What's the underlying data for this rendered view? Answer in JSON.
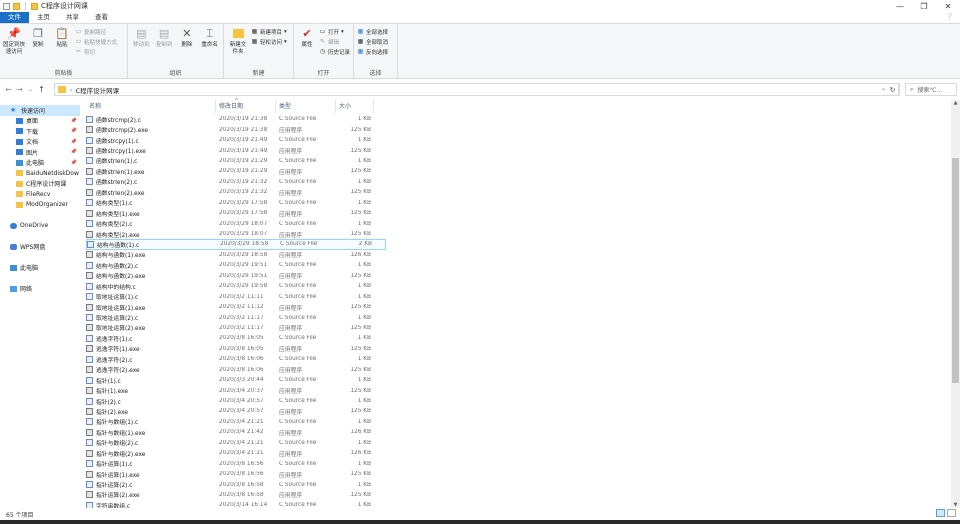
{
  "window": {
    "title": "C程序设计网课",
    "controls": [
      "—",
      "❐",
      "✕"
    ]
  },
  "tabs": [
    "文件",
    "主页",
    "共享",
    "查看"
  ],
  "ribbon": {
    "clipboard": {
      "label": "剪贴板",
      "pin": "固定到快速访问",
      "copy": "复制",
      "paste": "粘贴",
      "copy_path": "复制路径",
      "paste_shortcut": "粘贴快捷方式",
      "cut": "剪切"
    },
    "organize": {
      "label": "组织",
      "move_to": "移动到",
      "copy_to": "复制到",
      "delete": "删除",
      "rename": "重命名"
    },
    "new": {
      "label": "新建",
      "new_folder": "新建文件夹",
      "new_item": "新建项目",
      "easy_access": "轻松访问"
    },
    "open": {
      "label": "打开",
      "properties": "属性",
      "open": "打开",
      "edit": "编辑",
      "history": "历史记录"
    },
    "select": {
      "label": "选择",
      "select_all": "全部选择",
      "select_none": "全部取消",
      "invert": "反向选择"
    }
  },
  "address": {
    "path": "C程序设计网课",
    "search_placeholder": "搜索\"C..."
  },
  "navpane": [
    {
      "label": "快速访问",
      "icon": "star",
      "sel": true,
      "pin": false
    },
    {
      "label": "桌面",
      "icon": "blue",
      "sel": false,
      "pin": true
    },
    {
      "label": "下载",
      "icon": "blue",
      "sel": false,
      "pin": true
    },
    {
      "label": "文档",
      "icon": "blue",
      "sel": false,
      "pin": true
    },
    {
      "label": "图片",
      "icon": "blue",
      "sel": false,
      "pin": true
    },
    {
      "label": "此电脑",
      "icon": "pc",
      "sel": false,
      "pin": true
    },
    {
      "label": "BaiduNetdiskDow",
      "icon": "folder",
      "sel": false,
      "pin": false
    },
    {
      "label": "C程序设计网课",
      "icon": "folder",
      "sel": false,
      "pin": false
    },
    {
      "label": "FileRecv",
      "icon": "folder",
      "sel": false,
      "pin": false
    },
    {
      "label": "ModOrganizer",
      "icon": "folder",
      "sel": false,
      "pin": false
    },
    {
      "label": "",
      "icon": "",
      "sel": false,
      "pin": false
    },
    {
      "label": "OneDrive",
      "icon": "cloud",
      "sel": false,
      "pin": false
    },
    {
      "label": "",
      "icon": "",
      "sel": false,
      "pin": false
    },
    {
      "label": "WPS网盘",
      "icon": "wps",
      "sel": false,
      "pin": false
    },
    {
      "label": "",
      "icon": "",
      "sel": false,
      "pin": false
    },
    {
      "label": "此电脑",
      "icon": "pc",
      "sel": false,
      "pin": false
    },
    {
      "label": "",
      "icon": "",
      "sel": false,
      "pin": false
    },
    {
      "label": "网络",
      "icon": "net",
      "sel": false,
      "pin": false
    }
  ],
  "columns": {
    "name": "名称",
    "date": "修改日期",
    "type": "类型",
    "size": "大小"
  },
  "files": [
    {
      "name": "函数strcmp(2).c",
      "date": "2020/3/19 21:38",
      "type": "C Source File",
      "size": "1 KB",
      "exe": false
    },
    {
      "name": "函数strcmp(2).exe",
      "date": "2020/3/19 21:38",
      "type": "应用程序",
      "size": "125 KB",
      "exe": true
    },
    {
      "name": "函数strcpy(1).c",
      "date": "2020/3/19 21:49",
      "type": "C Source File",
      "size": "1 KB",
      "exe": false
    },
    {
      "name": "函数strcpy(1).exe",
      "date": "2020/3/19 21:49",
      "type": "应用程序",
      "size": "125 KB",
      "exe": true
    },
    {
      "name": "函数strlen(1).c",
      "date": "2020/3/19 21:29",
      "type": "C Source File",
      "size": "1 KB",
      "exe": false
    },
    {
      "name": "函数strlen(1).exe",
      "date": "2020/3/19 21:29",
      "type": "应用程序",
      "size": "125 KB",
      "exe": true
    },
    {
      "name": "函数strlen(2).c",
      "date": "2020/3/19 21:32",
      "type": "C Source File",
      "size": "1 KB",
      "exe": false
    },
    {
      "name": "函数strlen(2).exe",
      "date": "2020/3/19 21:32",
      "type": "应用程序",
      "size": "125 KB",
      "exe": true
    },
    {
      "name": "结构类型(1).c",
      "date": "2020/3/29 17:58",
      "type": "C Source File",
      "size": "1 KB",
      "exe": false
    },
    {
      "name": "结构类型(1).exe",
      "date": "2020/3/29 17:58",
      "type": "应用程序",
      "size": "125 KB",
      "exe": true
    },
    {
      "name": "结构类型(2).c",
      "date": "2020/3/29 18:07",
      "type": "C Source File",
      "size": "1 KB",
      "exe": false
    },
    {
      "name": "结构类型(2).exe",
      "date": "2020/3/29 18:07",
      "type": "应用程序",
      "size": "125 KB",
      "exe": true
    },
    {
      "name": "结构与函数(1).c",
      "date": "2020/3/29 18:58",
      "type": "C Source File",
      "size": "2 KB",
      "exe": false,
      "hl": true
    },
    {
      "name": "结构与函数(1).exe",
      "date": "2020/3/29 18:58",
      "type": "应用程序",
      "size": "126 KB",
      "exe": true
    },
    {
      "name": "结构与函数(2).c",
      "date": "2020/3/29 19:51",
      "type": "C Source File",
      "size": "1 KB",
      "exe": false
    },
    {
      "name": "结构与函数(2).exe",
      "date": "2020/3/29 19:51",
      "type": "应用程序",
      "size": "125 KB",
      "exe": true
    },
    {
      "name": "结构中的结构.c",
      "date": "2020/3/29 19:58",
      "type": "C Source File",
      "size": "1 KB",
      "exe": false
    },
    {
      "name": "取地址运算(1).c",
      "date": "2020/3/2 11:11",
      "type": "C Source File",
      "size": "1 KB",
      "exe": false
    },
    {
      "name": "取地址运算(1).exe",
      "date": "2020/3/2 11:12",
      "type": "应用程序",
      "size": "125 KB",
      "exe": true
    },
    {
      "name": "取地址运算(2).c",
      "date": "2020/3/2 11:17",
      "type": "C Source File",
      "size": "1 KB",
      "exe": false
    },
    {
      "name": "取地址运算(2).exe",
      "date": "2020/3/2 11:17",
      "type": "应用程序",
      "size": "125 KB",
      "exe": true
    },
    {
      "name": "逃逸字符(1).c",
      "date": "2020/3/8 16:05",
      "type": "C Source File",
      "size": "1 KB",
      "exe": false
    },
    {
      "name": "逃逸字符(1).exe",
      "date": "2020/3/8 16:05",
      "type": "应用程序",
      "size": "125 KB",
      "exe": true
    },
    {
      "name": "逃逸字符(2).c",
      "date": "2020/3/8 16:06",
      "type": "C Source File",
      "size": "1 KB",
      "exe": false
    },
    {
      "name": "逃逸字符(2).exe",
      "date": "2020/3/8 16:06",
      "type": "应用程序",
      "size": "125 KB",
      "exe": true
    },
    {
      "name": "指针(1).c",
      "date": "2020/3/3 20:44",
      "type": "C Source File",
      "size": "1 KB",
      "exe": false
    },
    {
      "name": "指针(1).exe",
      "date": "2020/3/4 20:37",
      "type": "应用程序",
      "size": "125 KB",
      "exe": true
    },
    {
      "name": "指针(2).c",
      "date": "2020/3/4 20:57",
      "type": "C Source File",
      "size": "1 KB",
      "exe": false
    },
    {
      "name": "指针(2).exe",
      "date": "2020/3/4 20:57",
      "type": "应用程序",
      "size": "125 KB",
      "exe": true
    },
    {
      "name": "指针与数组(1).c",
      "date": "2020/3/4 21:21",
      "type": "C Source File",
      "size": "1 KB",
      "exe": false
    },
    {
      "name": "指针与数组(1).exe",
      "date": "2020/3/4 21:42",
      "type": "应用程序",
      "size": "126 KB",
      "exe": true
    },
    {
      "name": "指针与数组(2).c",
      "date": "2020/3/4 21:21",
      "type": "C Source File",
      "size": "1 KB",
      "exe": false
    },
    {
      "name": "指针与数组(2).exe",
      "date": "2020/3/4 21:21",
      "type": "应用程序",
      "size": "126 KB",
      "exe": true
    },
    {
      "name": "指针运算(1).c",
      "date": "2020/3/8 16:56",
      "type": "C Source File",
      "size": "1 KB",
      "exe": false
    },
    {
      "name": "指针运算(1).exe",
      "date": "2020/3/8 16:56",
      "type": "应用程序",
      "size": "125 KB",
      "exe": true
    },
    {
      "name": "指针运算(2).c",
      "date": "2020/3/8 16:58",
      "type": "C Source File",
      "size": "1 KB",
      "exe": false
    },
    {
      "name": "指针运算(2).exe",
      "date": "2020/3/8 16:58",
      "type": "应用程序",
      "size": "125 KB",
      "exe": true
    },
    {
      "name": "字符串数组.c",
      "date": "2020/3/14 16:14",
      "type": "C Source File",
      "size": "1 KB",
      "exe": false
    }
  ],
  "status": {
    "count": "65 个项目"
  },
  "colors": {
    "accent": "#1a6fc7",
    "selection": "#cce8ff",
    "hover_border": "#99d1ff"
  }
}
